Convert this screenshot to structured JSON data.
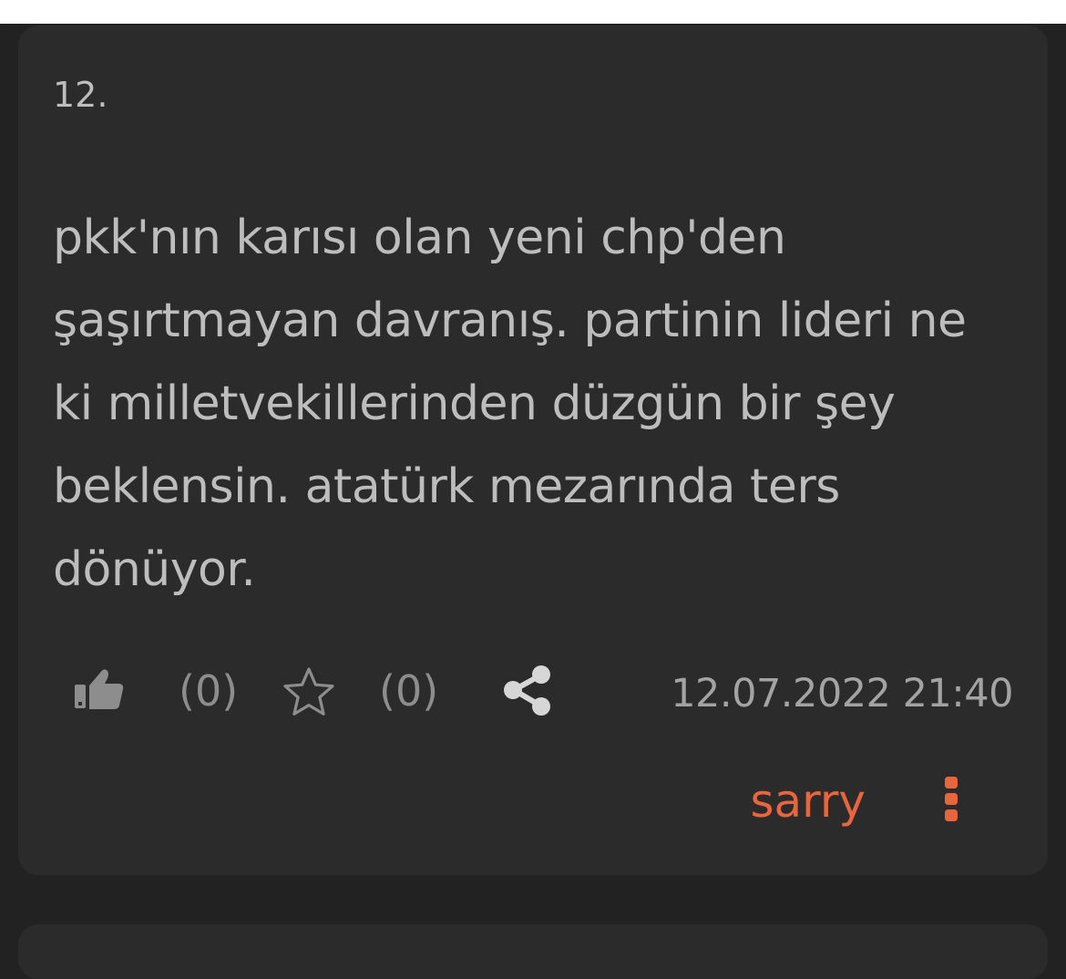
{
  "entry": {
    "number": "12.",
    "text_lines": [
      "pkk'nın karısı olan yeni chp'den",
      "şaşırtmayan davranış. partinin lideri ne",
      "ki milletvekillerinden düzgün bir şey",
      "beklensin. atatürk mezarında ters",
      "dönüyor."
    ],
    "like_count": "(0)",
    "favorite_count": "(0)",
    "date": "12.07.2022 21:40",
    "author": "sarry"
  },
  "icons": {
    "like": "thumbs-up-icon",
    "favorite": "star-outline-icon",
    "share": "share-icon",
    "more": "vertical-dots-icon"
  },
  "colors": {
    "background": "#222222",
    "card": "#2b2b2b",
    "text": "#bdbdbd",
    "muted": "#8d8d8d",
    "accent": "#e8663d"
  }
}
